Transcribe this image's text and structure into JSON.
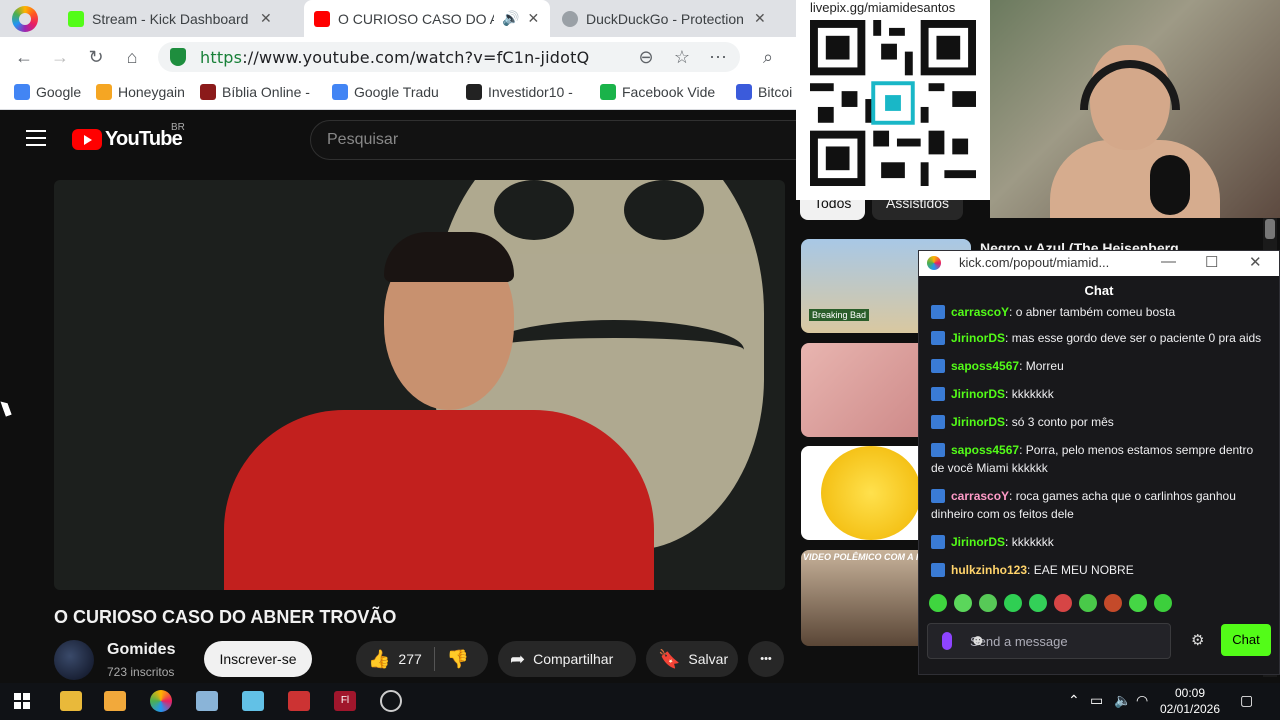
{
  "colors": {
    "youtube_red": "#ff0000",
    "kick_green": "#53fc18",
    "url_secure_green": "#188038",
    "chat_bg": "#18181b",
    "video_red_shirt": "#c2201e"
  },
  "browser": {
    "tabs": [
      {
        "title": "Stream - Kick Dashboard",
        "icon": "kick-icon",
        "close": "✕"
      },
      {
        "title": "O CURIOSO CASO DO A",
        "icon": "youtube-icon",
        "close": "✕",
        "audio": "🔊"
      },
      {
        "title": "DuckDuckGo - Protection",
        "icon": "globe-icon",
        "close": "✕"
      }
    ],
    "url_proto": "https",
    "url_rest": "://www.youtube.com/watch?v=fC1n-jidotQ",
    "bookmarks": [
      {
        "label": "Google",
        "icon": "google-icon",
        "color": "#4285f4"
      },
      {
        "label": "Honeygain",
        "icon": "honeygain-icon",
        "color": "#f5a623"
      },
      {
        "label": "Bíblia Online -",
        "icon": "bible-icon",
        "color": "#8b1a1a"
      },
      {
        "label": "Google Tradu",
        "icon": "translate-icon",
        "color": "#4285f4"
      },
      {
        "label": "Investidor10 -",
        "icon": "investidor-icon",
        "color": "#222222"
      },
      {
        "label": "Facebook Vide",
        "icon": "facebook-icon",
        "color": "#1ab34a"
      },
      {
        "label": "Bitcoi",
        "icon": "bitcoin-icon",
        "color": "#3b5bdb"
      }
    ]
  },
  "youtube": {
    "logo_text": "YouTube",
    "region": "BR",
    "search_placeholder": "Pesquisar",
    "video_title": "O CURIOSO CASO DO ABNER TROVÃO",
    "channel": {
      "name": "Gomides",
      "subs": "723 inscritos"
    },
    "subscribe_label": "Inscrever-se",
    "likes": "277",
    "share_label": "Compartilhar",
    "save_label": "Salvar",
    "more_label": "•••",
    "chips": [
      "Todos",
      "Assistidos"
    ],
    "rec_title": "Negro y Azul (The Heisenberg",
    "thumbs": [
      {
        "caption": "Breaking Bad",
        "color": "#8fb3d6"
      },
      {
        "caption": "",
        "color": "#d9a0a0"
      },
      {
        "caption": "",
        "color": "#f3c221"
      },
      {
        "caption": "VIDEO POLÊMICO COM A REAL",
        "color": "#6a5540"
      }
    ]
  },
  "overlay": {
    "qr_url": "livepix.gg/miamidesantos"
  },
  "chat": {
    "window_url": "kick.com/popout/miamid...",
    "title": "Chat",
    "messages": [
      {
        "user": "carrascoY",
        "color": "#53fc18",
        "text": "o abner também comeu bosta"
      },
      {
        "user": "JirinorDS",
        "color": "#53fc18",
        "text": "mas esse gordo deve ser o paciente 0 pra aids"
      },
      {
        "user": "saposs4567",
        "color": "#53fc18",
        "text": "Morreu"
      },
      {
        "user": "JirinorDS",
        "color": "#53fc18",
        "text": "kkkkkkk"
      },
      {
        "user": "JirinorDS",
        "color": "#53fc18",
        "text": "só 3 conto por mês"
      },
      {
        "user": "saposs4567",
        "color": "#53fc18",
        "text": "Porra, pelo menos estamos sempre dentro de você Miami kkkkkk"
      },
      {
        "user": "carrascoY",
        "color": "#ff9bc8",
        "text": "roca games acha que o carlinhos ganhou dinheiro com os feitos dele"
      },
      {
        "user": "JirinorDS",
        "color": "#53fc18",
        "text": "kkkkkkk"
      },
      {
        "user": "hulkzinho123",
        "color": "#ffd36b",
        "text": "EAE MEU NOBRE"
      }
    ],
    "input_placeholder": "Send a message",
    "send_label": "Chat",
    "emote_colors": [
      "#3fd53f",
      "#5bd65b",
      "#57c957",
      "#2fcf53",
      "#33d058",
      "#d64545",
      "#49c949",
      "#c44a2a",
      "#45d645",
      "#3ccf3c"
    ]
  },
  "taskbar": {
    "time": "00:09",
    "date": "02/01/2026"
  }
}
